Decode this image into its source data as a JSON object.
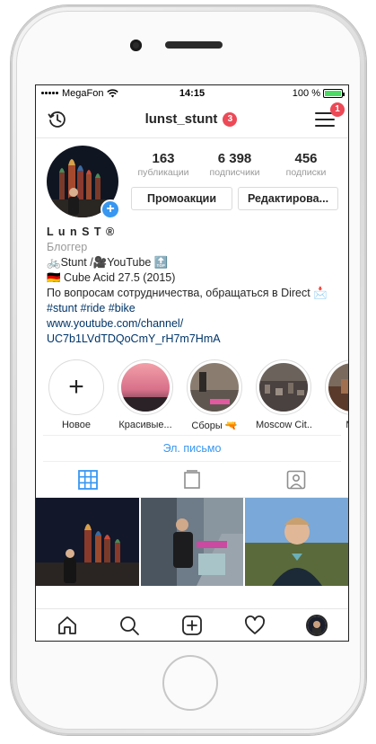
{
  "status_bar": {
    "carrier": "MegaFon",
    "time": "14:15",
    "battery_text": "100 %",
    "battery_level": 1.0
  },
  "header": {
    "username": "lunst_stunt",
    "username_badge": "3",
    "menu_badge": "1"
  },
  "profile": {
    "stats": [
      {
        "value": "163",
        "label": "публикации"
      },
      {
        "value": "6 398",
        "label": "подписчики"
      },
      {
        "value": "456",
        "label": "подписки"
      }
    ],
    "buttons": {
      "promo": "Промоакции",
      "edit": "Редактирова..."
    }
  },
  "bio": {
    "name": "L u n S T ®",
    "category": "Блоггер",
    "line1": "🚲Stunt /🎥YouTube 🔝",
    "line2": "🇩🇪 Cube Acid 27.5 (2015)",
    "line3": "По вопросам сотрудничества, обращаться в Direct 📩",
    "hashtags": "#stunt #ride #bike",
    "link_line1": "www.youtube.com/channel/",
    "link_line2": "UC7b1LVdTDQoCmY_rH7m7HmA"
  },
  "highlights": [
    {
      "label": "Новое"
    },
    {
      "label": "Красивые..."
    },
    {
      "label": "Сборы 🔫"
    },
    {
      "label": "Moscow Cit..."
    },
    {
      "label": "Ma"
    }
  ],
  "email_button": "Эл. письмо",
  "colors": {
    "accent": "#3897f0",
    "badge": "#ed4956",
    "link": "#003569",
    "muted": "#999999"
  },
  "icons": {
    "header_left": "history-clock-icon",
    "header_right": "hamburger-menu-icon",
    "tabs": [
      "grid-icon",
      "igtv-icon",
      "tagged-person-icon"
    ],
    "bottom_nav": [
      "home-icon",
      "search-icon",
      "new-post-icon",
      "heart-icon",
      "profile-avatar-icon"
    ]
  }
}
